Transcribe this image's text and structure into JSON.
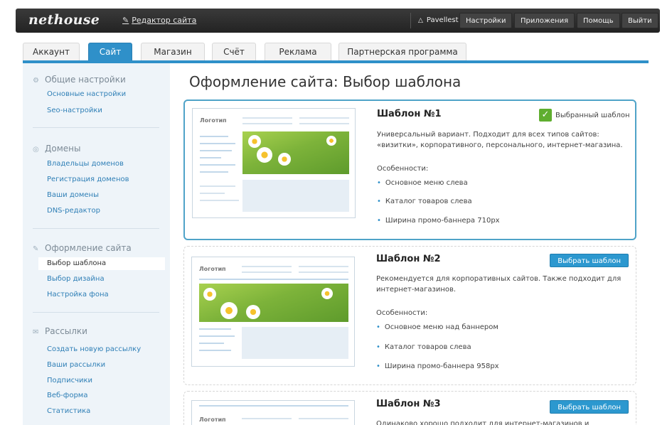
{
  "topbar": {
    "logo": "nethouse",
    "editor_link": "Редактор сайта",
    "user": "Pavellest",
    "nav": [
      "Настройки",
      "Приложения",
      "Помощь",
      "Выйти"
    ]
  },
  "tabs": [
    {
      "label": "Аккаунт",
      "active": false
    },
    {
      "label": "Сайт",
      "active": true
    },
    {
      "label": "Магазин",
      "active": false
    },
    {
      "label": "Счёт",
      "active": false
    },
    {
      "label": "Реклама",
      "active": false
    },
    {
      "label": "Партнерская программа",
      "active": false
    }
  ],
  "sidebar": {
    "sections": [
      {
        "title": "Общие настройки",
        "icon": "gear-icon",
        "links": [
          "Основные настройки",
          "Seo-настройки"
        ]
      },
      {
        "title": "Домены",
        "icon": "globe-icon",
        "links": [
          "Владельцы доменов",
          "Регистрация доменов",
          "Ваши домены",
          "DNS-редактор"
        ]
      },
      {
        "title": "Оформление сайта",
        "icon": "pencil-icon",
        "links": [
          "Выбор шаблона",
          "Выбор дизайна",
          "Настройка фона"
        ],
        "active_index": 0
      },
      {
        "title": "Рассылки",
        "icon": "mail-icon",
        "links": [
          "Создать новую рассылку",
          "Ваши рассылки",
          "Подписчики",
          "Веб-форма",
          "Статистика"
        ]
      }
    ]
  },
  "main": {
    "title": "Оформление сайта: Выбор шаблона",
    "thumb_logo": "Логотип",
    "features_heading": "Особенности:",
    "selected_label": "Выбранный шаблон",
    "choose_label": "Выбрать шаблон",
    "templates": [
      {
        "name": "Шаблон №1",
        "selected": true,
        "description": "Универсальный вариант. Подходит для всех типов сайтов: «визитки», корпоративного, персонального, интернет-магазина.",
        "features": [
          "Основное меню слева",
          "Каталог товаров слева",
          "Ширина промо-баннера 710px"
        ]
      },
      {
        "name": "Шаблон №2",
        "selected": false,
        "description": "Рекомендуется для корпоративных сайтов. Также подходит для интернет-магазинов.",
        "features": [
          "Основное меню над баннером",
          "Каталог товаров слева",
          "Ширина промо-баннера 958px"
        ]
      },
      {
        "name": "Шаблон №3",
        "selected": false,
        "description": "Одинаково хорошо подходит для интернет-магазинов и",
        "features": []
      }
    ]
  },
  "colors": {
    "accent": "#2f90c9",
    "topbar": "#2b2b2b",
    "sidebar_bg": "#eef4f9",
    "selected_border": "#4fa3c8",
    "check_green": "#5fae2f"
  }
}
